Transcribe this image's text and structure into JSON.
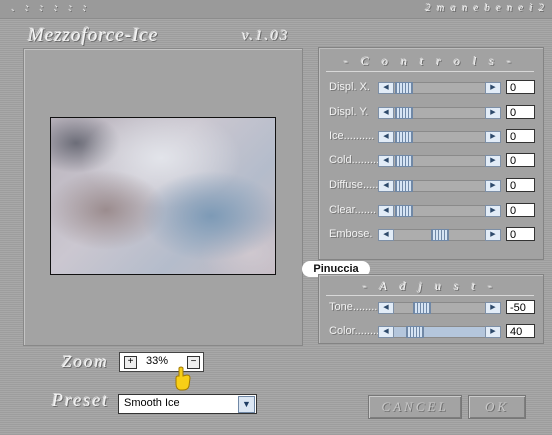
{
  "header": {
    "dots": ". : : : : :",
    "vendor": "2 m a n e b e n e i  2"
  },
  "app": {
    "title": "Mezzoforce-Ice",
    "version": "v.1.03"
  },
  "controls": {
    "title": "- C o n t r o l s -",
    "sliders": [
      {
        "label": "Displ. X.",
        "value": "0"
      },
      {
        "label": "Displ. Y.",
        "value": "0"
      },
      {
        "label": "Ice..........",
        "value": "0"
      },
      {
        "label": "Cold.........",
        "value": "0"
      },
      {
        "label": "Diffuse.....",
        "value": "0"
      },
      {
        "label": "Clear.......",
        "value": "0"
      },
      {
        "label": "Embose.",
        "value": "0"
      }
    ]
  },
  "adjust": {
    "title": "- A d j u s t -",
    "sliders": [
      {
        "label": "Tone.........",
        "value": "-50"
      },
      {
        "label": "Color........",
        "value": "40"
      }
    ]
  },
  "zoom": {
    "label": "Zoom",
    "value": "33%",
    "plus": "+",
    "minus": "−"
  },
  "preset": {
    "label": "Preset",
    "value": "Smooth Ice"
  },
  "buttons": {
    "cancel": "CANCEL",
    "ok": "OK"
  },
  "watermark": "Pinuccia",
  "icons": {
    "left_arrow": "left-arrow-icon",
    "right_arrow": "right-arrow-icon",
    "dropdown": "chevron-down-icon",
    "pointer": "hand-pointer-icon"
  }
}
